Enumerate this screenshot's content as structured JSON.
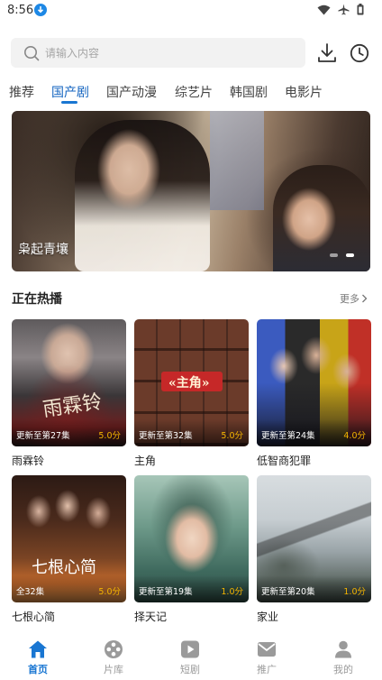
{
  "status_bar": {
    "time": "8:56"
  },
  "search": {
    "placeholder": "请输入内容"
  },
  "tabs": [
    {
      "label": "推荐"
    },
    {
      "label": "国产剧"
    },
    {
      "label": "国产动漫"
    },
    {
      "label": "综艺片"
    },
    {
      "label": "韩国剧"
    },
    {
      "label": "电影片"
    }
  ],
  "active_tab": "国产剧",
  "banner": {
    "title": "枭起青壤",
    "slide_count": 2,
    "active_slide": 2
  },
  "section": {
    "title": "正在热播",
    "more_label": "更多"
  },
  "cards": [
    {
      "title": "雨霖铃",
      "status": "更新至第27集",
      "score": "5.0分",
      "poster_text": "雨霖铃"
    },
    {
      "title": "主角",
      "status": "更新至第32集",
      "score": "5.0分",
      "poster_text": "«主角»"
    },
    {
      "title": "低智商犯罪",
      "status": "更新至第24集",
      "score": "4.0分",
      "poster_text": ""
    },
    {
      "title": "七根心简",
      "status": "全32集",
      "score": "5.0分",
      "poster_text": "七根心简"
    },
    {
      "title": "择天记",
      "status": "更新至第19集",
      "score": "1.0分",
      "poster_text": ""
    },
    {
      "title": "家业",
      "status": "更新至第20集",
      "score": "1.0分",
      "poster_text": ""
    }
  ],
  "bottom_nav": [
    {
      "label": "首页",
      "icon": "home-icon",
      "active": true
    },
    {
      "label": "片库",
      "icon": "film-reel-icon",
      "active": false
    },
    {
      "label": "短剧",
      "icon": "play-icon",
      "active": false
    },
    {
      "label": "推广",
      "icon": "mail-icon",
      "active": false
    },
    {
      "label": "我的",
      "icon": "user-icon",
      "active": false
    }
  ],
  "colors": {
    "accent": "#1976d2",
    "score": "#f4b400",
    "nav_inactive": "#9a9a9a"
  }
}
